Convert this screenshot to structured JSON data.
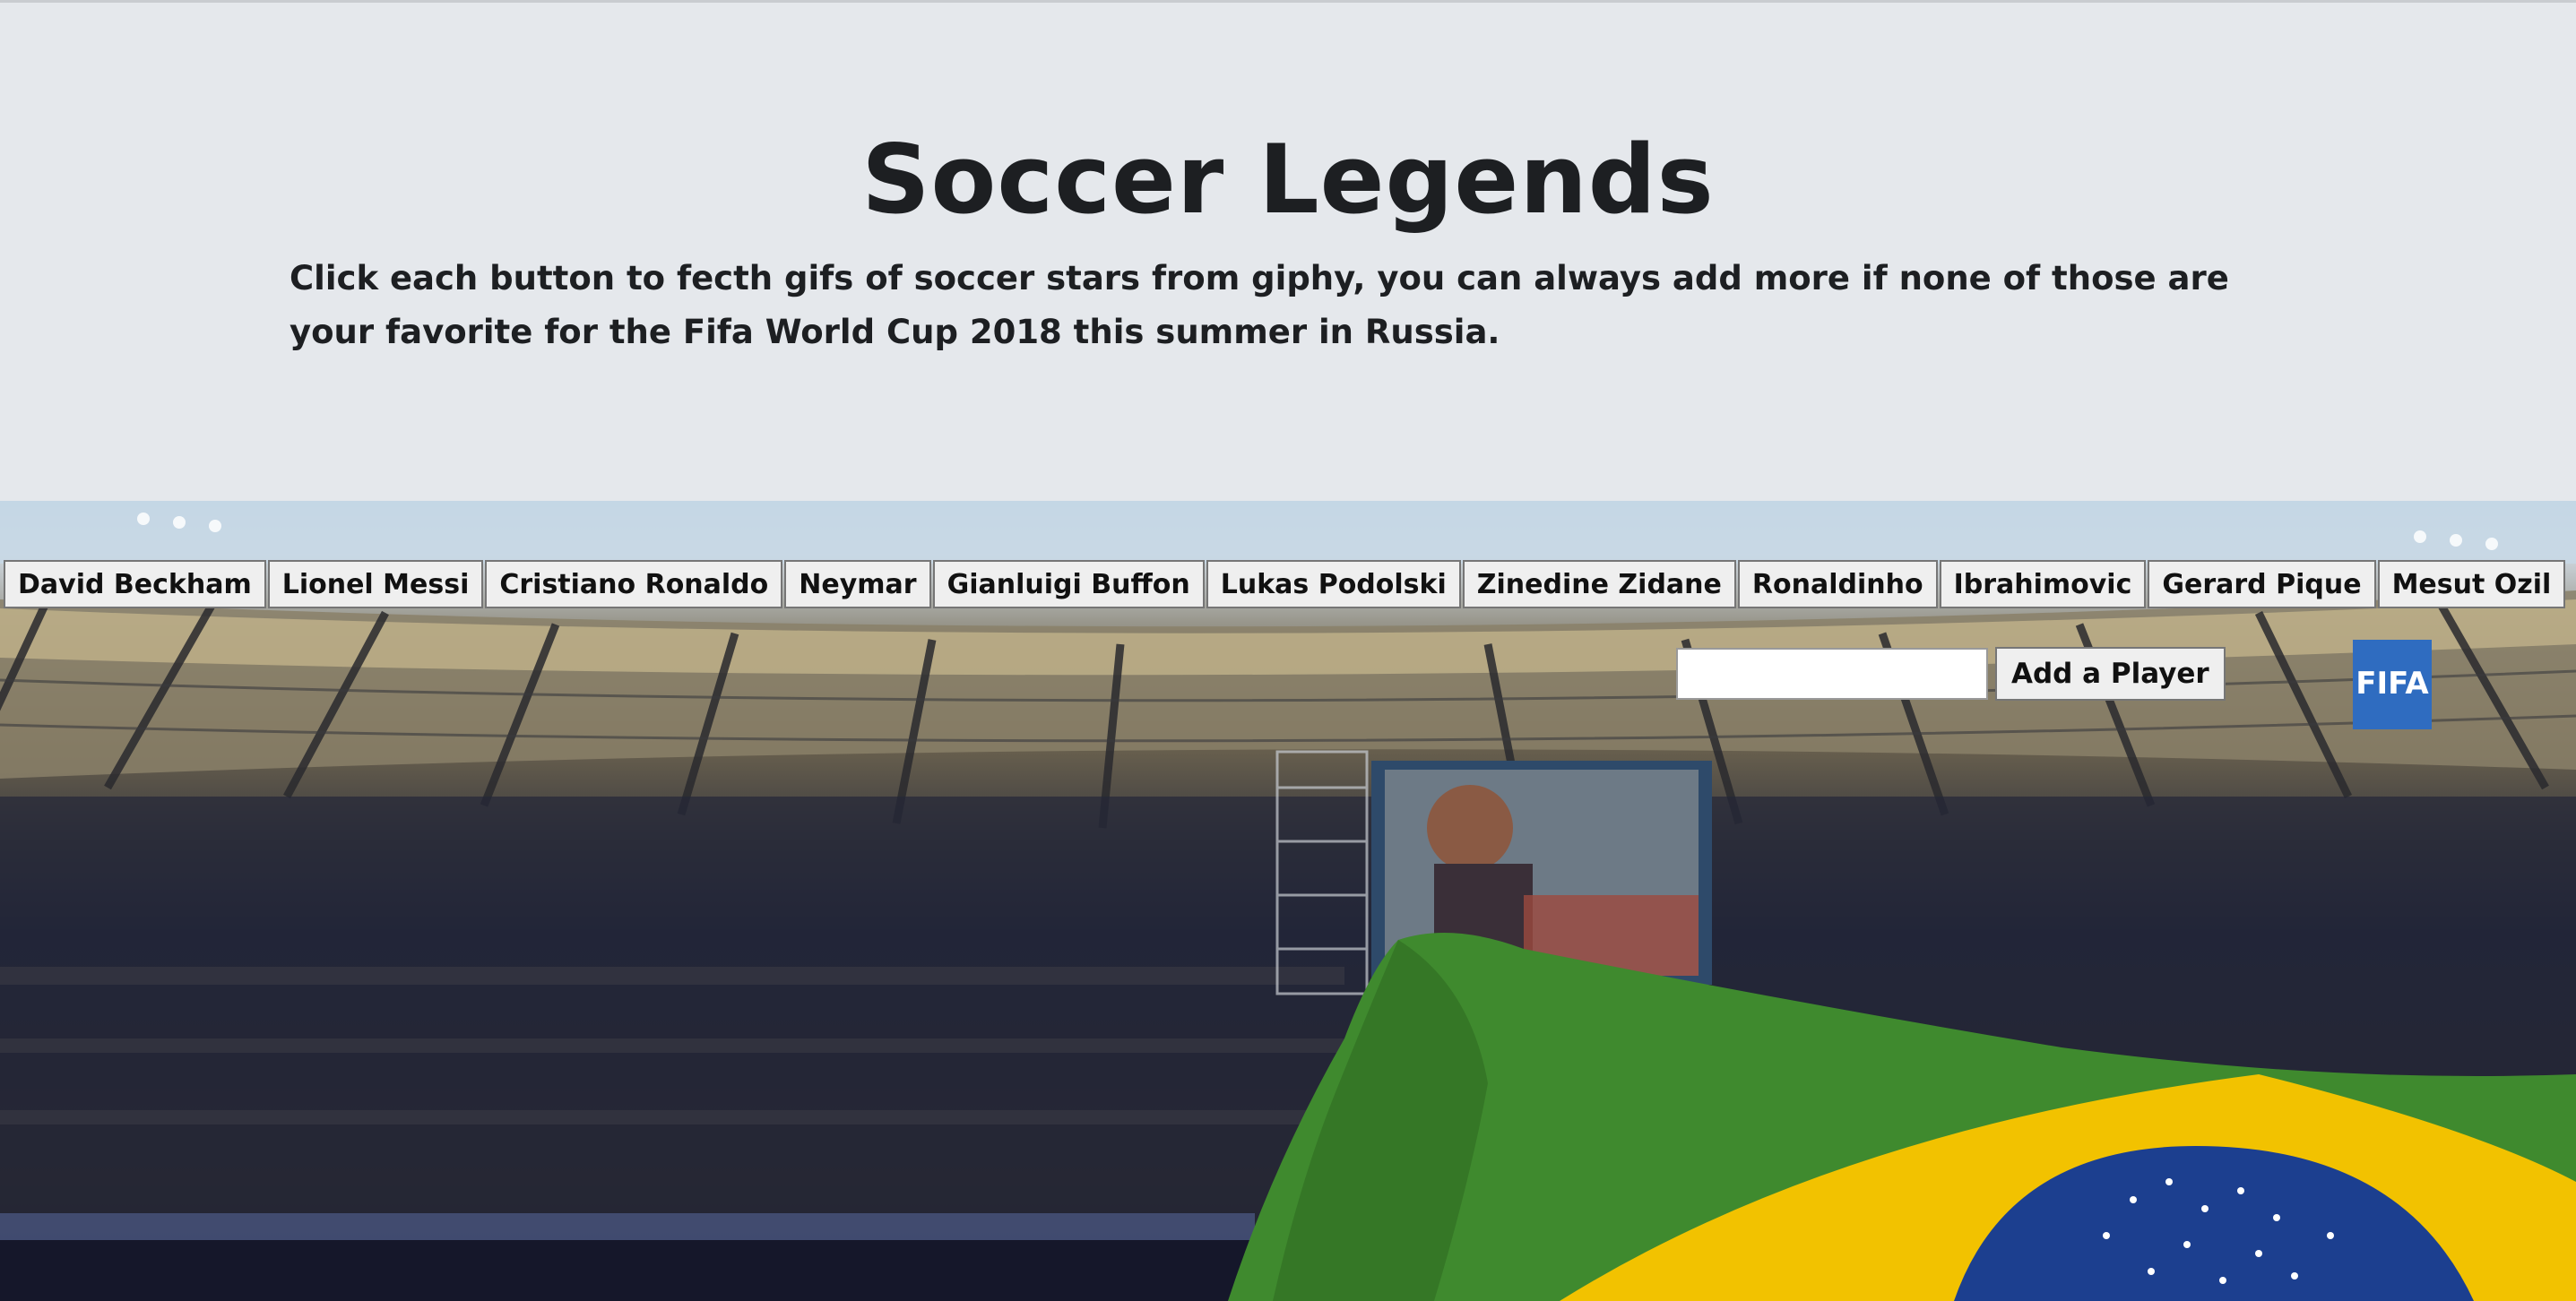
{
  "header": {
    "title": "Soccer Legends",
    "description": "Click each button to fecth gifs of soccer stars from giphy, you can always add more if none of those are your favorite for the Fifa World Cup 2018 this summer in Russia."
  },
  "players": [
    "David Beckham",
    "Lionel Messi",
    "Cristiano Ronaldo",
    "Neymar",
    "Gianluigi Buffon",
    "Lukas Podolski",
    "Zinedine Zidane",
    "Ronaldinho",
    "Ibrahimovic",
    "Gerard Pique",
    "Mesut Ozil"
  ],
  "add_form": {
    "input_value": "",
    "button_label": "Add a Player"
  },
  "background": {
    "banner_text": "FIFA"
  },
  "colors": {
    "header_bg": "#e5e8ec",
    "text": "#1d1f22",
    "button_bg": "#efefef",
    "flag_green": "#3f8a2e",
    "flag_yellow": "#f2c200",
    "flag_blue": "#1c3f8f"
  }
}
